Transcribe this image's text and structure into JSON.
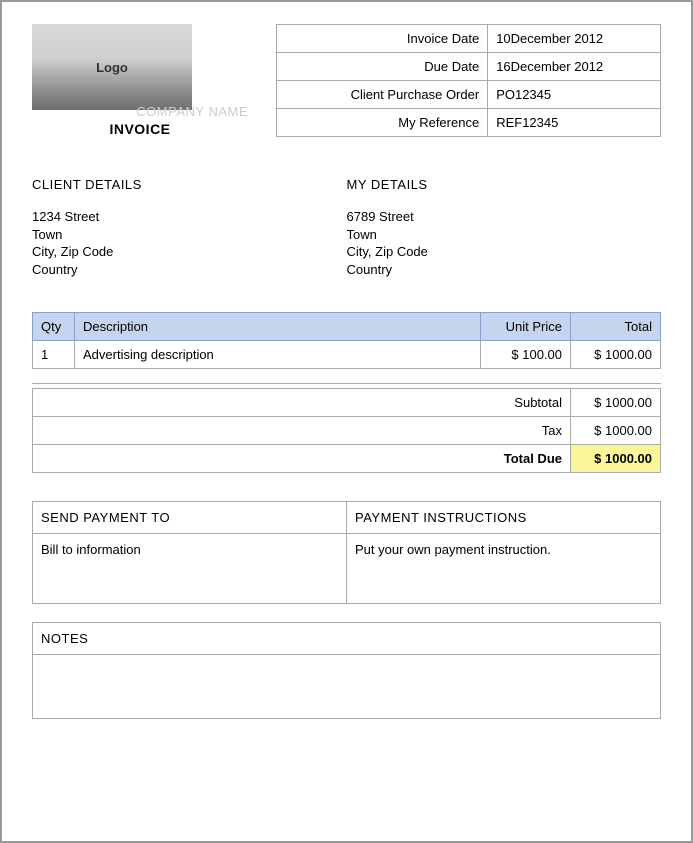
{
  "logo_text": "Logo",
  "company_name_label": "COMPANY NAME",
  "invoice_title": "INVOICE",
  "meta": {
    "invoice_date_label": "Invoice Date",
    "invoice_date_value": "10December  2012",
    "due_date_label": "Due Date",
    "due_date_value": "16December  2012",
    "cpo_label": "Client Purchase Order",
    "cpo_value": "PO12345",
    "ref_label": "My Reference",
    "ref_value": "REF12345"
  },
  "client_details": {
    "heading": "CLIENT DETAILS",
    "line1": "1234 Street",
    "line2": "Town",
    "line3": "City, Zip Code",
    "line4": "Country"
  },
  "my_details": {
    "heading": "MY DETAILS",
    "line1": "6789 Street",
    "line2": "Town",
    "line3": "City, Zip Code",
    "line4": "Country"
  },
  "items": {
    "headers": {
      "qty": "Qty",
      "desc": "Description",
      "unit": "Unit Price",
      "total": "Total"
    },
    "rows": [
      {
        "qty": "1",
        "desc": "Advertising description",
        "unit": "$ 100.00",
        "total": "$ 1000.00"
      }
    ]
  },
  "totals": {
    "subtotal_label": "Subtotal",
    "subtotal_value": "$ 1000.00",
    "tax_label": "Tax",
    "tax_value": "$ 1000.00",
    "total_due_label": "Total Due",
    "total_due_value": "$ 1000.00"
  },
  "payment": {
    "send_to_heading": "SEND PAYMENT TO",
    "send_to_body": "Bill to information",
    "instructions_heading": "PAYMENT INSTRUCTIONS",
    "instructions_body": "Put your own payment instruction."
  },
  "notes": {
    "heading": "NOTES",
    "body": ""
  }
}
